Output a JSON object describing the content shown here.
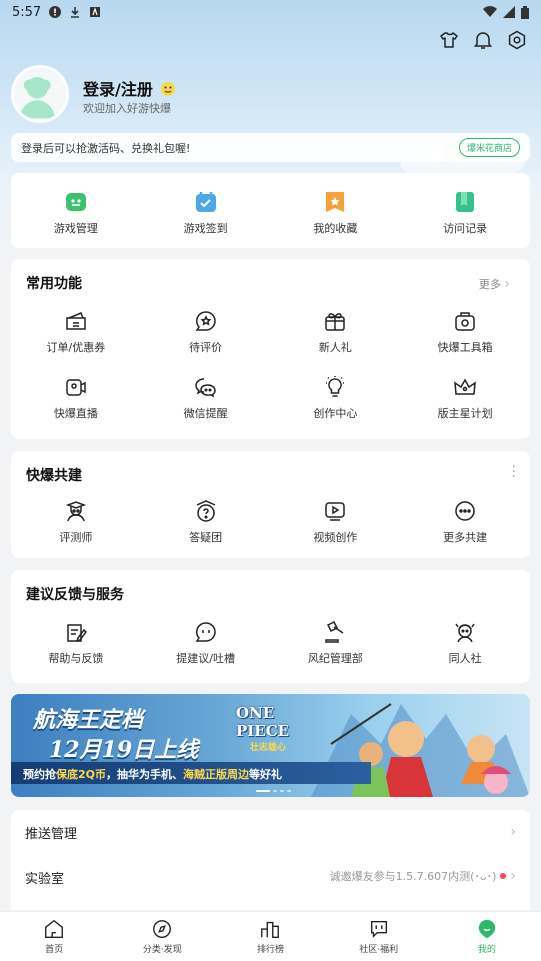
{
  "status_bar": {
    "time": "5:57"
  },
  "profile": {
    "login_label": "登录/注册",
    "welcome": "欢迎加入好游快爆"
  },
  "tip": {
    "text": "登录后可以抢激活码、兑换礼包喔!",
    "button": "爆米花商店"
  },
  "quick": [
    {
      "label": "游戏管理",
      "icon": "gamepad-icon"
    },
    {
      "label": "游戏签到",
      "icon": "checkin-icon"
    },
    {
      "label": "我的收藏",
      "icon": "favorite-icon"
    },
    {
      "label": "访问记录",
      "icon": "history-icon"
    }
  ],
  "common": {
    "title": "常用功能",
    "more": "更多",
    "items": [
      {
        "label": "订单/优惠券",
        "icon": "coupon-icon"
      },
      {
        "label": "待评价",
        "icon": "review-icon"
      },
      {
        "label": "新人礼",
        "icon": "gift-icon"
      },
      {
        "label": "快爆工具箱",
        "icon": "toolbox-icon"
      },
      {
        "label": "快爆直播",
        "icon": "live-icon"
      },
      {
        "label": "微信提醒",
        "icon": "wechat-icon"
      },
      {
        "label": "创作中心",
        "icon": "bulb-icon"
      },
      {
        "label": "版主星计划",
        "icon": "crown-icon"
      }
    ]
  },
  "cobuild": {
    "title": "快爆共建",
    "items": [
      {
        "label": "评测师",
        "icon": "reviewer-icon"
      },
      {
        "label": "答疑团",
        "icon": "question-icon"
      },
      {
        "label": "视频创作",
        "icon": "video-icon"
      },
      {
        "label": "更多共建",
        "icon": "more-icon"
      }
    ]
  },
  "feedback": {
    "title": "建议反馈与服务",
    "items": [
      {
        "label": "帮助与反馈",
        "icon": "help-icon"
      },
      {
        "label": "提建议/吐槽",
        "icon": "suggest-icon"
      },
      {
        "label": "风纪管理部",
        "icon": "gavel-icon"
      },
      {
        "label": "同人社",
        "icon": "fan-club-icon"
      }
    ]
  },
  "banner": {
    "title": "航海王定档",
    "subtitle": "12月19日上线",
    "strip_pre": "预约抢",
    "strip_hl1": "保底2Q币",
    "strip_mid": "，抽华为手机、",
    "strip_hl2": "海贼正版周边",
    "strip_post": "等好礼",
    "logo_text": "ONE PIECE",
    "logo_sub": "壮志雄心"
  },
  "rows": [
    {
      "label": "推送管理",
      "value": ""
    },
    {
      "label": "实验室",
      "value": "诚邀爆友参与1.5.7.607内测(･ᴗ･)"
    }
  ],
  "tabs": [
    {
      "label": "首页",
      "icon": "home-icon"
    },
    {
      "label": "分类·发现",
      "icon": "compass-icon"
    },
    {
      "label": "排行榜",
      "icon": "ranking-icon"
    },
    {
      "label": "社区·福利",
      "icon": "community-icon"
    },
    {
      "label": "我的",
      "icon": "profile-icon",
      "active": true
    }
  ],
  "colors": {
    "accent": "#2fb86a",
    "quick_green": "#3cc26f",
    "quick_blue": "#4da6e8",
    "quick_orange": "#f3a33a",
    "quick_teal": "#39c08f"
  }
}
